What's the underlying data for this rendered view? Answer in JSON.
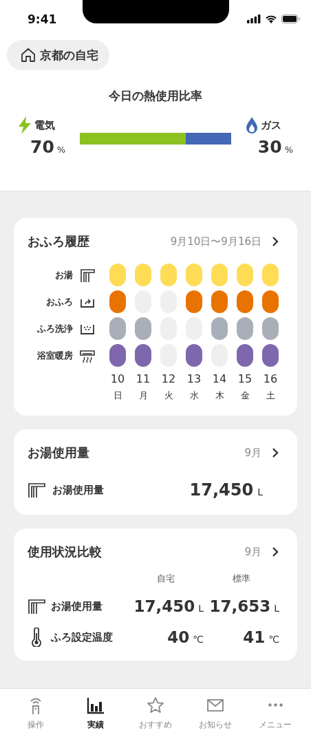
{
  "status_bar": {
    "time": "9:41"
  },
  "home": {
    "label": "京都の自宅"
  },
  "heat_ratio": {
    "title": "今日の熱使用比率",
    "electric": {
      "label": "電気",
      "value": "70",
      "unit": "%",
      "level": 0.7
    },
    "gas": {
      "label": "ガス",
      "value": "30",
      "unit": "%"
    }
  },
  "bath_history": {
    "title": "おふろ履歴",
    "range": "9月10日〜9月16日",
    "rows": [
      {
        "label": "お湯",
        "kind": "hot-water",
        "color": "#ffdc55",
        "days": [
          {
            "on": true
          },
          {
            "on": true
          },
          {
            "on": true
          },
          {
            "on": true
          },
          {
            "on": true
          },
          {
            "on": true
          },
          {
            "on": true
          }
        ]
      },
      {
        "label": "おふろ",
        "kind": "bath",
        "color": "#e97300",
        "days": [
          {
            "on": true
          },
          {
            "on": false
          },
          {
            "on": false
          },
          {
            "on": true
          },
          {
            "on": true
          },
          {
            "on": true
          },
          {
            "on": true
          }
        ]
      },
      {
        "label": "ふろ洗浄",
        "kind": "cleaning",
        "color": "#a9afb8",
        "days": [
          {
            "on": true
          },
          {
            "on": true
          },
          {
            "on": false
          },
          {
            "on": false
          },
          {
            "on": true
          },
          {
            "on": true
          },
          {
            "on": true
          }
        ]
      },
      {
        "label": "浴室暖房",
        "kind": "heating",
        "color": "#7e67ad",
        "days": [
          {
            "on": true
          },
          {
            "on": true
          },
          {
            "on": false
          },
          {
            "on": true
          },
          {
            "on": false
          },
          {
            "on": true
          },
          {
            "on": true
          }
        ]
      }
    ],
    "dates": [
      {
        "date": "10",
        "weekday": "日"
      },
      {
        "date": "11",
        "weekday": "月"
      },
      {
        "date": "12",
        "weekday": "火"
      },
      {
        "date": "13",
        "weekday": "水"
      },
      {
        "date": "14",
        "weekday": "木"
      },
      {
        "date": "15",
        "weekday": "金"
      },
      {
        "date": "16",
        "weekday": "土"
      }
    ]
  },
  "hot_water_usage": {
    "title": "お湯使用量",
    "period": "9月",
    "label": "お湯使用量",
    "value": "17,450",
    "unit": "L"
  },
  "comparison": {
    "title": "使用状況比較",
    "period": "9月",
    "columns": [
      "自宅",
      "標準"
    ],
    "rows": [
      {
        "label": "お湯使用量",
        "kind": "hot-water",
        "values": [
          {
            "value": "17,450",
            "unit": "L"
          },
          {
            "value": "17,653",
            "unit": "L"
          }
        ]
      },
      {
        "label": "ふろ設定温度",
        "kind": "temperature",
        "values": [
          {
            "value": "40",
            "unit": "℃"
          },
          {
            "value": "41",
            "unit": "℃"
          }
        ]
      }
    ]
  },
  "tabs": [
    {
      "label": "操作",
      "kind": "remote",
      "selected": false
    },
    {
      "label": "実績",
      "kind": "chart",
      "selected": true
    },
    {
      "label": "おすすめ",
      "kind": "star",
      "selected": false
    },
    {
      "label": "お知らせ",
      "kind": "mail",
      "selected": false
    },
    {
      "label": "メニュー",
      "kind": "more",
      "selected": false
    }
  ]
}
